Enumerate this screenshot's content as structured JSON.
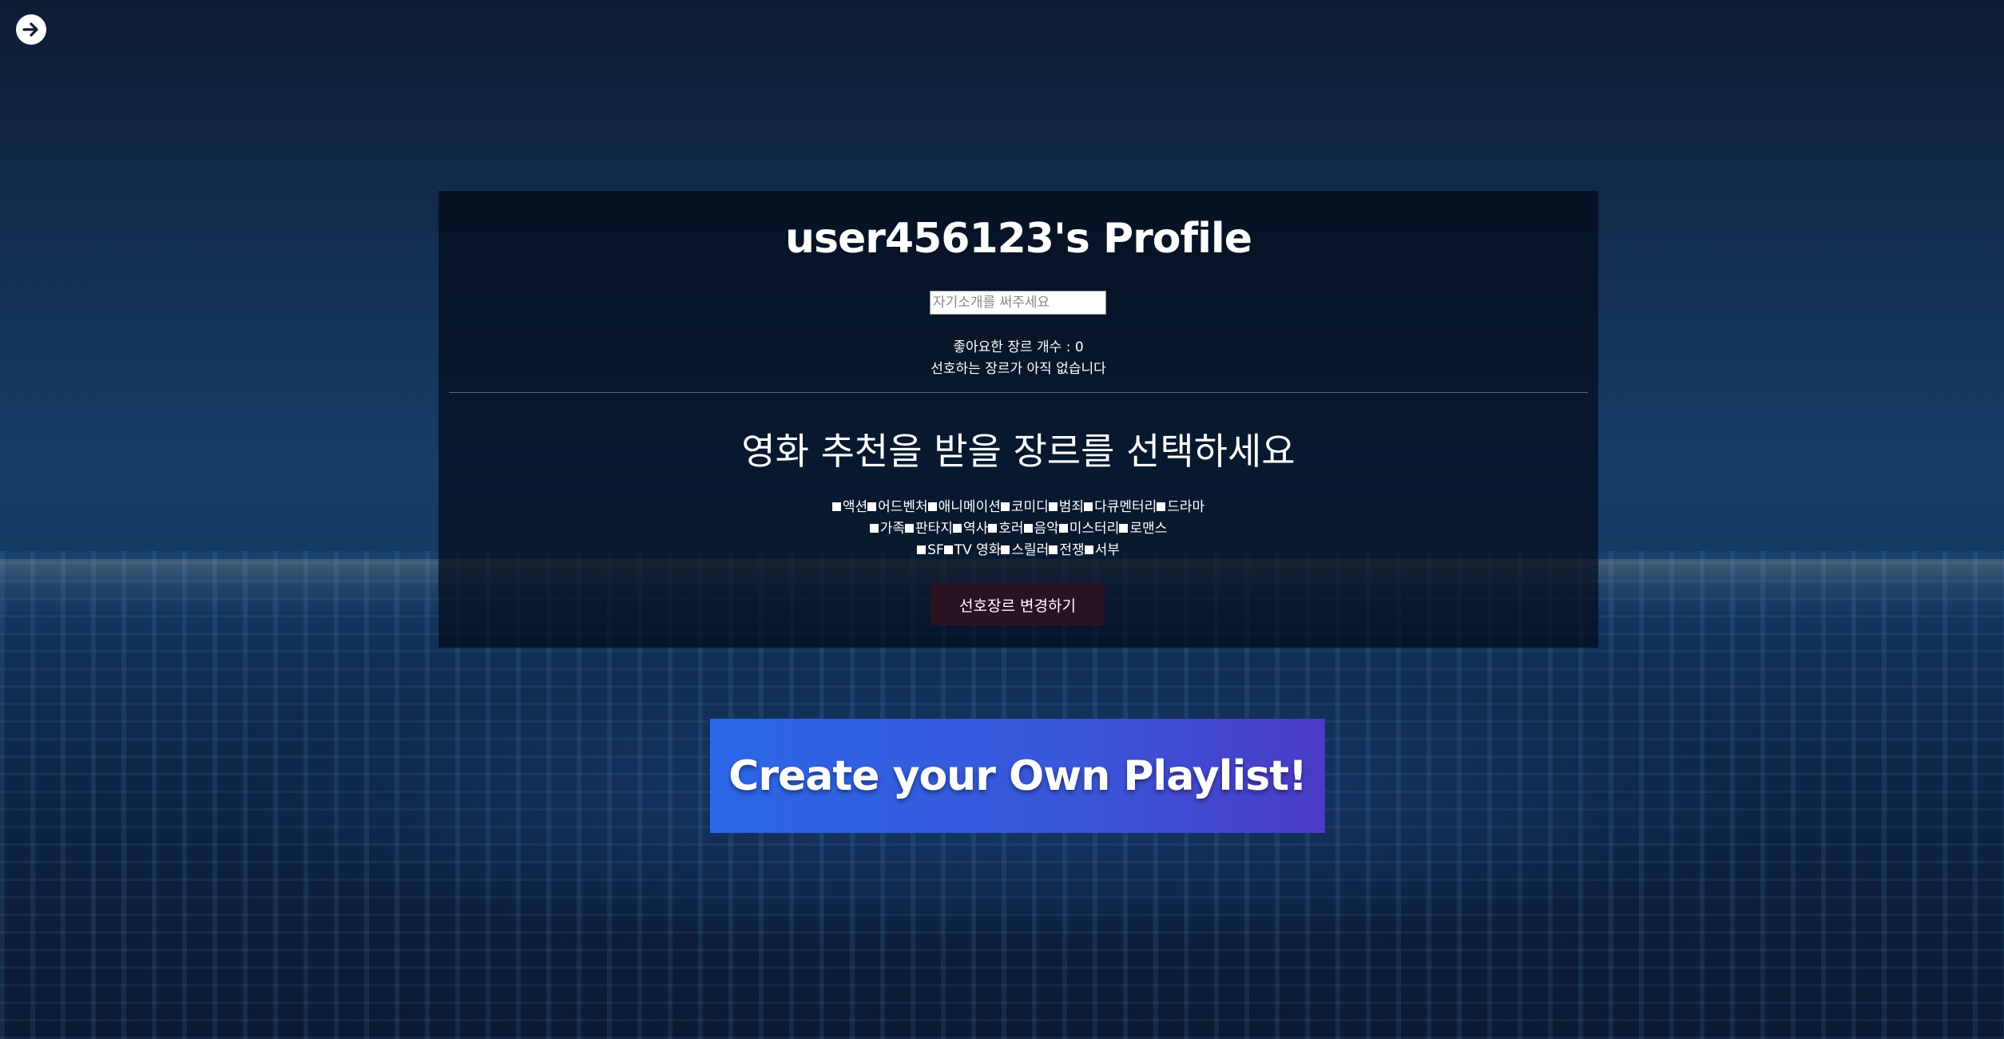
{
  "nav": {
    "back_icon": "arrow-right-circle-icon"
  },
  "profile": {
    "title": "user456123's Profile",
    "bio_placeholder": "자기소개를 써주세요",
    "bio_value": "",
    "liked_genre_count": "좋아요한 장르 개수 : 0",
    "no_genre_text": "선호하는 장르가 아직 없습니다"
  },
  "genre_selector": {
    "heading": "영화 추천을 받을 장르를 선택하세요",
    "rows": [
      [
        "액션",
        "어드벤처",
        "애니메이션",
        "코미디",
        "범죄",
        "다큐멘터리",
        "드라마"
      ],
      [
        "가족",
        "판타지",
        "역사",
        "호러",
        "음악",
        "미스터리",
        "로맨스"
      ],
      [
        "SF",
        "TV 영화",
        "스릴러",
        "전쟁",
        "서부"
      ]
    ],
    "submit_label": "선호장르 변경하기"
  },
  "cta": {
    "playlist_label": "Create your Own Playlist!"
  },
  "colors": {
    "card_bg": "#020610",
    "submit_bg": "#2b1222",
    "cta_start": "#2a68e8",
    "cta_end": "#4a3bc6"
  }
}
